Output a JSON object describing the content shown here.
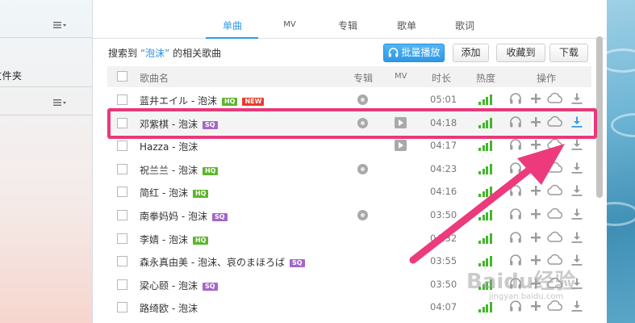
{
  "left_pane": {
    "folder_label": "文件夹"
  },
  "tabs": [
    {
      "label": "单曲",
      "active": true
    },
    {
      "label": "MV",
      "active": false
    },
    {
      "label": "专辑",
      "active": false
    },
    {
      "label": "歌单",
      "active": false
    },
    {
      "label": "歌词",
      "active": false
    }
  ],
  "search": {
    "prefix": "搜索到",
    "keyword": "“泡沫”",
    "suffix": "的相关歌曲"
  },
  "toolbar": {
    "play_all_label": "批量播放",
    "add_label": "添加",
    "favorite_label": "收藏到",
    "download_label": "下载"
  },
  "table": {
    "columns": [
      "歌曲名",
      "专辑",
      "MV",
      "时长",
      "热度",
      "操作"
    ],
    "rows": [
      {
        "name": "蓝井エイル - 泡沫",
        "badges": [
          "HQ",
          "NEW"
        ],
        "album": true,
        "mv": false,
        "duration": "05:01",
        "highlighted": false
      },
      {
        "name": "邓紫棋 - 泡沫",
        "badges": [
          "SQ"
        ],
        "album": true,
        "mv": true,
        "duration": "04:18",
        "highlighted": true
      },
      {
        "name": "Hazza - 泡沫",
        "badges": [],
        "album": false,
        "mv": true,
        "duration": "04:17",
        "highlighted": false
      },
      {
        "name": "祝兰兰 - 泡沫",
        "badges": [
          "HQ"
        ],
        "album": true,
        "mv": false,
        "duration": "04:23",
        "highlighted": false
      },
      {
        "name": "简红 - 泡沫",
        "badges": [
          "HQ"
        ],
        "album": false,
        "mv": false,
        "duration": "04:16",
        "highlighted": false
      },
      {
        "name": "南拳妈妈 - 泡沫",
        "badges": [
          "SQ"
        ],
        "album": true,
        "mv": false,
        "duration": "03:50",
        "highlighted": false
      },
      {
        "name": "李婧 - 泡沫",
        "badges": [
          "HQ"
        ],
        "album": false,
        "mv": false,
        "duration": "04:32",
        "highlighted": false
      },
      {
        "name": "森永真由美 - 泡沫、哀のまほろば",
        "badges": [
          "SQ"
        ],
        "album": false,
        "mv": false,
        "duration": "03:55",
        "highlighted": false
      },
      {
        "name": "梁心颐 - 泡沫",
        "badges": [
          "SQ"
        ],
        "album": false,
        "mv": false,
        "duration": "03:50",
        "highlighted": false
      },
      {
        "name": "路绮欧 - 泡沫",
        "badges": [],
        "album": false,
        "mv": false,
        "duration": "04:07",
        "highlighted": false
      }
    ]
  },
  "watermark": {
    "logo": "Baidu经验",
    "url": "jingyan.baidu.com"
  },
  "colors": {
    "accent": "#2e9ce8",
    "highlight_border": "#e8397a",
    "heat_green": "#42b72a",
    "hq_badge": "#5cb52b",
    "sq_badge": "#a467c8",
    "new_badge": "#e63c2b"
  },
  "icons": {
    "menu": "list-menu-icon",
    "play_all": "headphones-icon",
    "album": "disc-icon",
    "mv": "video-play-icon",
    "heat": "signal-bars-icon",
    "listen": "headphones-icon",
    "add": "plus-icon",
    "collect": "cloud-icon",
    "download": "download-icon",
    "annotation": "arrow-annotation"
  }
}
